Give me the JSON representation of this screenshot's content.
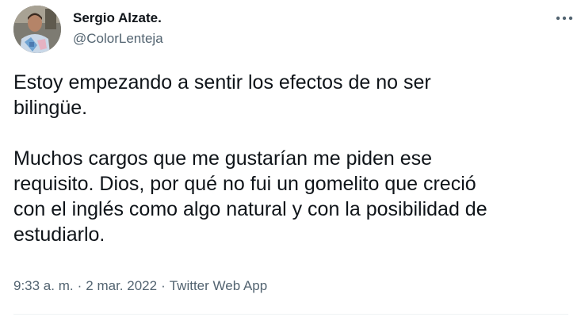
{
  "author": {
    "name": "Sergio Alzate.",
    "handle": "@ColorLenteja"
  },
  "tweet": {
    "paragraphs": [
      "Estoy empezando a sentir los efectos de no ser\nbilingüe.",
      "Muchos cargos que me gustarían me piden ese\nrequisito. Dios, por qué no fui un gomelito que creció\ncon el inglés como algo natural y con la posibilidad de\nestudiarlo."
    ]
  },
  "meta": {
    "time": "9:33 a. m.",
    "separator": "·",
    "date": "2 mar. 2022",
    "source": "Twitter Web App"
  },
  "icons": {
    "more": "more-options-icon"
  },
  "colors": {
    "text_primary": "#0f1419",
    "text_secondary": "#536471",
    "divider": "#eff3f4",
    "background": "#ffffff"
  }
}
